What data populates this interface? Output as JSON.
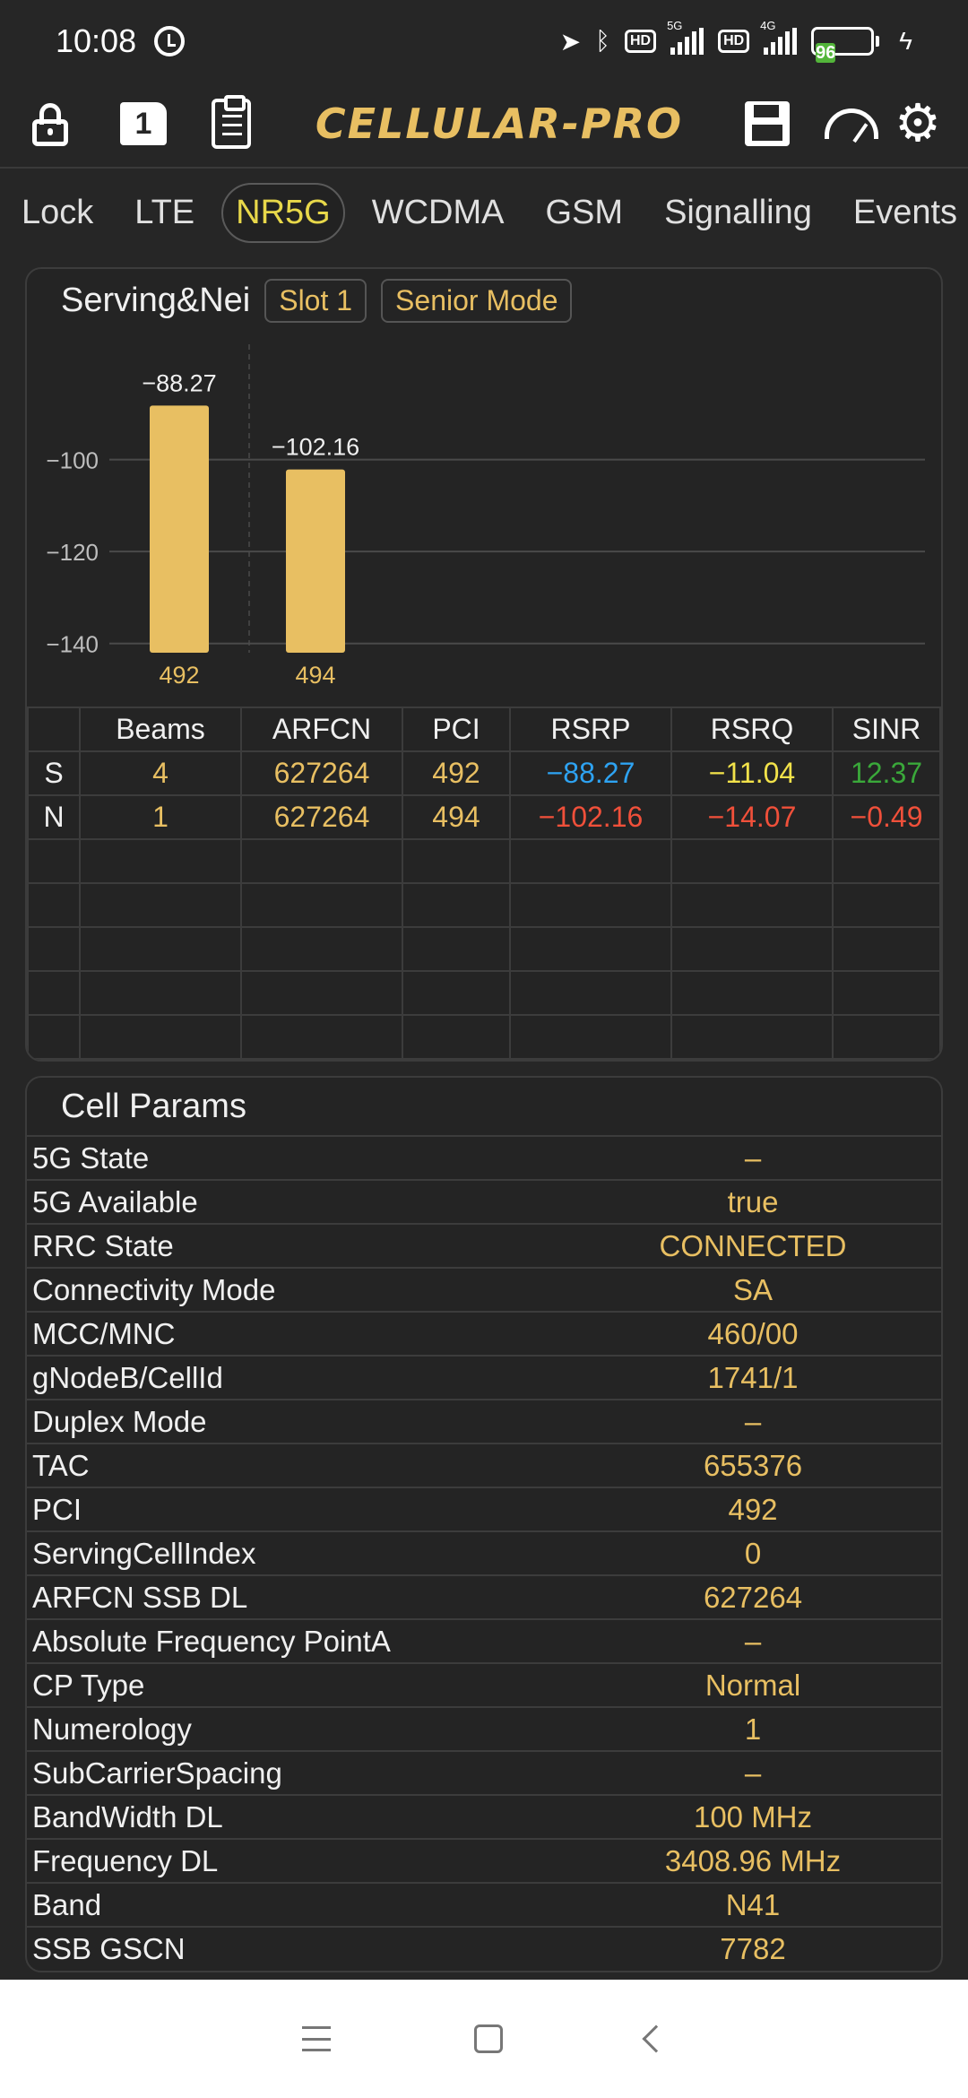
{
  "status_bar": {
    "time": "10:08",
    "hd1": "HD",
    "net1": "5G",
    "hd2": "HD",
    "net2": "4G",
    "battery": "96"
  },
  "toolbar": {
    "sim_label": "1",
    "brand": "CELLULAR-PRO"
  },
  "tabs": [
    "Lock",
    "LTE",
    "NR5G",
    "WCDMA",
    "GSM",
    "Signalling",
    "Events"
  ],
  "active_tab": "NR5G",
  "serving_panel": {
    "title": "Serving&Nei",
    "slot_button": "Slot 1",
    "mode_button": "Senior Mode"
  },
  "chart_data": {
    "type": "bar",
    "categories": [
      "492",
      "494"
    ],
    "values": [
      -88.27,
      -102.16
    ],
    "ylim": [
      -142,
      -80
    ],
    "yticks": [
      -100,
      -120,
      -140
    ],
    "ytick_labels": [
      "−100",
      "−120",
      "−140"
    ],
    "data_labels": [
      "−88.27",
      "−102.16"
    ],
    "bar_color": "#e8bf62",
    "grid": true
  },
  "cells_table": {
    "headers": [
      "",
      "Beams",
      "ARFCN",
      "PCI",
      "RSRP",
      "RSRQ",
      "SINR"
    ],
    "rows": [
      [
        "S",
        "4",
        "627264",
        "492",
        "−88.27",
        "−11.04",
        "12.37"
      ],
      [
        "N",
        "1",
        "627264",
        "494",
        "−102.16",
        "−14.07",
        "−0.49"
      ]
    ],
    "empty_rows": 5
  },
  "cell_params": {
    "title": "Cell Params",
    "rows": [
      {
        "key": "5G State",
        "value": "–"
      },
      {
        "key": "5G Available",
        "value": "true"
      },
      {
        "key": "RRC State",
        "value": "CONNECTED"
      },
      {
        "key": "Connectivity Mode",
        "value": "SA"
      },
      {
        "key": "MCC/MNC",
        "value": "460/00"
      },
      {
        "key": "gNodeB/CellId",
        "value": "1741/1"
      },
      {
        "key": "Duplex Mode",
        "value": "–"
      },
      {
        "key": "TAC",
        "value": "655376"
      },
      {
        "key": "PCI",
        "value": "492"
      },
      {
        "key": "ServingCellIndex",
        "value": "0"
      },
      {
        "key": "ARFCN SSB DL",
        "value": "627264"
      },
      {
        "key": "Absolute Frequency PointA",
        "value": "–"
      },
      {
        "key": "CP Type",
        "value": "Normal"
      },
      {
        "key": "Numerology",
        "value": "1"
      },
      {
        "key": "SubCarrierSpacing",
        "value": "–"
      },
      {
        "key": "BandWidth DL",
        "value": "100 MHz"
      },
      {
        "key": "Frequency DL",
        "value": "3408.96 MHz"
      },
      {
        "key": "Band",
        "value": "N41"
      },
      {
        "key": "SSB GSCN",
        "value": "7782"
      }
    ]
  },
  "colors": {
    "accent": "#e8bf62",
    "rsrp_good": "#2ea3f2",
    "rsrq_mid": "#f2e24a",
    "sinr_good": "#3aa83a",
    "bad": "#f0503a"
  }
}
